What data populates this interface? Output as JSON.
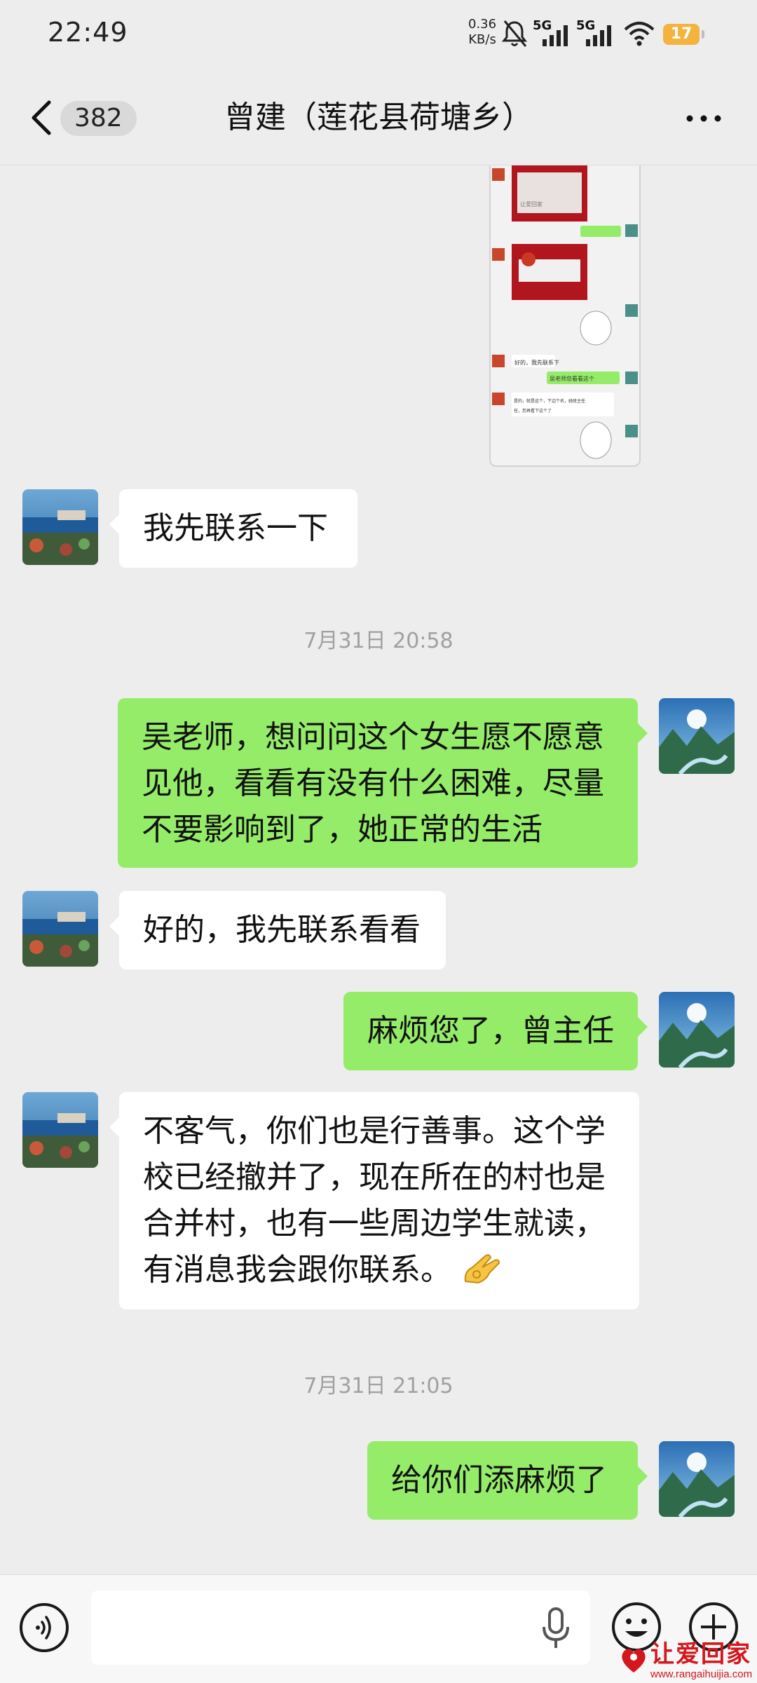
{
  "status_bar": {
    "time": "22:49",
    "speed_value": "0.36",
    "speed_unit": "KB/s",
    "network_1": "5G",
    "network_2": "5G",
    "battery": "17"
  },
  "header": {
    "unread_count": "382",
    "title": "曾建（莲花县荷塘乡）"
  },
  "shared_screenshot": {
    "lines": [
      "让爱回家",
      "吴老师您看看这个",
      "好的，我先联系下",
      "是的，就是这个，下边个名，她班主任",
      "任，您再看下这个了"
    ]
  },
  "messages": [
    {
      "side": "in",
      "text": "我先联系一下"
    },
    {
      "type": "timestamp",
      "text": "7月31日 20:58"
    },
    {
      "side": "out",
      "lines": [
        "吴老师，想问问这个女生愿不愿意",
        "见他，看看有没有什么困难，尽量",
        "不要影响到了，她正常的生活"
      ]
    },
    {
      "side": "in",
      "text": "好的，我先联系看看"
    },
    {
      "side": "out",
      "text": "麻烦您了，曾主任"
    },
    {
      "side": "in",
      "lines": [
        "不客气，你们也是行善事。这个学",
        "校已经撤并了，现在所在的村也是",
        "合并村，也有一些周边学生就读，",
        "有消息我会跟你联系。"
      ],
      "emoji": "ok-hand-emoji"
    },
    {
      "type": "timestamp",
      "text": "7月31日 21:05"
    },
    {
      "side": "out",
      "text": "给你们添麻烦了"
    }
  ],
  "input_bar": {
    "placeholder": ""
  },
  "watermark": {
    "text": "让爱回家",
    "url": "www.rangaihuijia.com"
  },
  "colors": {
    "background": "#ededed",
    "outgoing_bubble": "#95ec69",
    "incoming_bubble": "#ffffff",
    "battery": "#f3b33d",
    "watermark": "#d4161d"
  }
}
